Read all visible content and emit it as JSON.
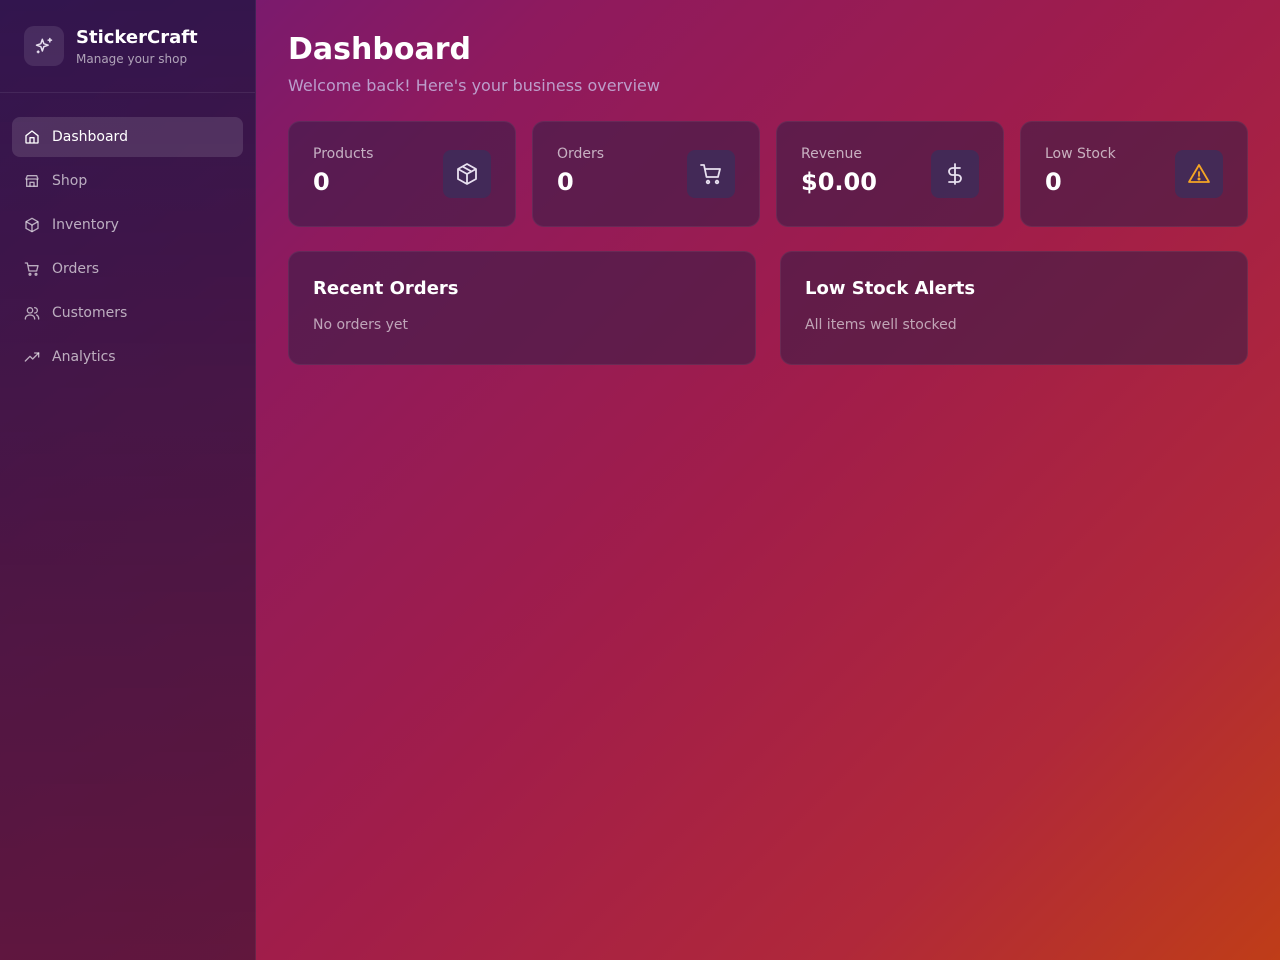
{
  "brand": {
    "name": "StickerCraft",
    "subtitle": "Manage your shop",
    "icon": "sparkles-icon"
  },
  "sidebar": {
    "items": [
      {
        "label": "Dashboard",
        "icon": "home-icon",
        "active": true
      },
      {
        "label": "Shop",
        "icon": "store-icon",
        "active": false
      },
      {
        "label": "Inventory",
        "icon": "box-icon",
        "active": false
      },
      {
        "label": "Orders",
        "icon": "cart-icon",
        "active": false
      },
      {
        "label": "Customers",
        "icon": "users-icon",
        "active": false
      },
      {
        "label": "Analytics",
        "icon": "trending-up-icon",
        "active": false
      }
    ]
  },
  "header": {
    "title": "Dashboard",
    "subtitle": "Welcome back! Here's your business overview"
  },
  "stats": [
    {
      "label": "Products",
      "value": "0",
      "icon": "box-icon"
    },
    {
      "label": "Orders",
      "value": "0",
      "icon": "cart-icon"
    },
    {
      "label": "Revenue",
      "value": "$0.00",
      "icon": "dollar-icon"
    },
    {
      "label": "Low Stock",
      "value": "0",
      "icon": "warning-icon",
      "icon_color": "#f5a524"
    }
  ],
  "panels": {
    "recent_orders": {
      "title": "Recent Orders",
      "empty": "No orders yet"
    },
    "low_stock": {
      "title": "Low Stock Alerts",
      "empty": "All items well stocked"
    }
  }
}
